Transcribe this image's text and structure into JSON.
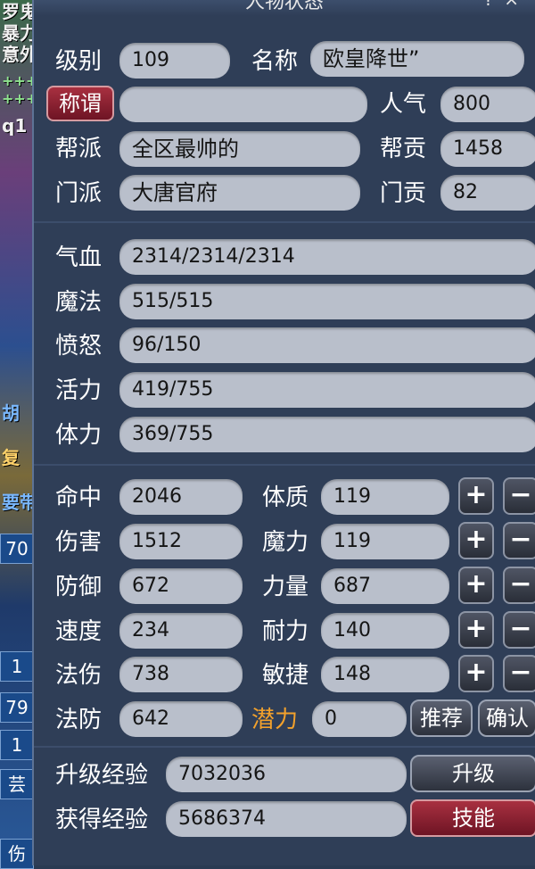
{
  "window": {
    "title": "人物状态",
    "controls": [
      "?",
      "×"
    ]
  },
  "left_strip": {
    "texts": [
      "罗鬼",
      "暴力",
      "意外",
      "+++",
      "+++",
      "q1",
      "胡",
      "复",
      "要带",
      "70",
      "1",
      "79",
      "1",
      "芸",
      "伤"
    ]
  },
  "profile": {
    "level_label": "级别",
    "level": "109",
    "name_label": "名称",
    "name": "欧皇降世”",
    "title_button": "称谓",
    "title_value": "",
    "popularity_label": "人气",
    "popularity": "800",
    "guild_label": "帮派",
    "guild": "全区最帅的",
    "guild_contrib_label": "帮贡",
    "guild_contrib": "1458",
    "school_label": "门派",
    "school": "大唐官府",
    "school_contrib_label": "门贡",
    "school_contrib": "82"
  },
  "vitals": {
    "hp_label": "气血",
    "hp": "2314/2314/2314",
    "mp_label": "魔法",
    "mp": "515/515",
    "rage_label": "愤怒",
    "rage": "96/150",
    "vigor_label": "活力",
    "vigor": "419/755",
    "stamina_label": "体力",
    "stamina": "369/755"
  },
  "combat": {
    "hit_label": "命中",
    "hit": "2046",
    "damage_label": "伤害",
    "damage": "1512",
    "defense_label": "防御",
    "defense": "672",
    "speed_label": "速度",
    "speed": "234",
    "spell_dmg_label": "法伤",
    "spell_dmg": "738",
    "spell_def_label": "法防",
    "spell_def": "642"
  },
  "attributes": {
    "con_label": "体质",
    "con": "119",
    "mag_label": "魔力",
    "mag": "119",
    "str_label": "力量",
    "str": "687",
    "end_label": "耐力",
    "end": "140",
    "agi_label": "敏捷",
    "agi": "148",
    "potential_label": "潜力",
    "potential": "0",
    "plus": "+",
    "minus": "−",
    "recommend_button": "推荐",
    "confirm_button": "确认"
  },
  "experience": {
    "upgrade_exp_label": "升级经验",
    "upgrade_exp": "7032036",
    "gained_exp_label": "获得经验",
    "gained_exp": "5686374",
    "level_up_button": "升级",
    "skills_button": "技能"
  },
  "colors": {
    "panel_bg": "#2f3e57",
    "field_bg": "#b9bfcb",
    "potential_label": "#f2a12c",
    "red_button": "#8a1f30"
  }
}
